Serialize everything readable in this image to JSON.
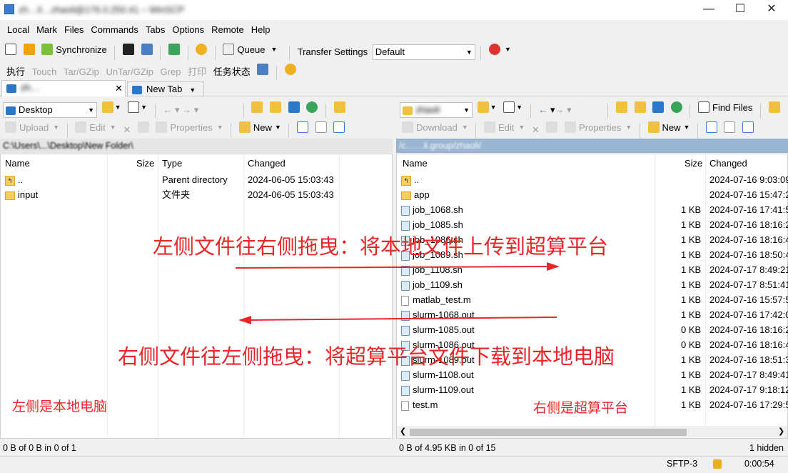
{
  "window": {
    "title": "zh…li…zhaoli@176.0.250.41 – WinSCP",
    "minimize": "—",
    "maximize": "☐",
    "close": "✕"
  },
  "menu": [
    "Local",
    "Mark",
    "Files",
    "Commands",
    "Tabs",
    "Options",
    "Remote",
    "Help"
  ],
  "toolbar1": {
    "synchronize": "Synchronize",
    "queue": "Queue",
    "transfer_settings": "Transfer Settings",
    "transfer_default": "Default"
  },
  "toolbar2": [
    "执行",
    "Touch",
    "Tar/GZip",
    "UnTar/GZip",
    "Grep",
    "打印",
    "任务状态"
  ],
  "tabs": {
    "session": "zh…",
    "new_tab": "New Tab"
  },
  "left": {
    "location": "Desktop",
    "upload": "Upload",
    "edit": "Edit",
    "properties": "Properties",
    "new": "New",
    "path": "C:\\Users\\...\\Desktop\\New Folder\\",
    "columns": {
      "name": "Name",
      "size": "Size",
      "type": "Type",
      "changed": "Changed"
    },
    "rows": [
      {
        "name": "..",
        "size": "",
        "type": "Parent directory",
        "changed": "2024-06-05 15:03:43"
      },
      {
        "name": "input",
        "size": "",
        "type": "文件夹",
        "changed": "2024-06-05 15:03:43"
      }
    ],
    "status": "0 B of 0 B in 0 of 1"
  },
  "right": {
    "location": "zhaoli",
    "find_files": "Find Files",
    "download": "Download",
    "edit": "Edit",
    "properties": "Properties",
    "new": "New",
    "path": "/c……li.group/zhaoli/",
    "columns": {
      "name": "Name",
      "size": "Size",
      "changed": "Changed"
    },
    "rows": [
      {
        "icon": "up",
        "name": "..",
        "size": "",
        "changed": "2024-07-16 9:03:09"
      },
      {
        "icon": "folder",
        "name": "app",
        "size": "",
        "changed": "2024-07-16 15:47:2"
      },
      {
        "icon": "file",
        "name": "job_1068.sh",
        "size": "1 KB",
        "changed": "2024-07-16 17:41:5"
      },
      {
        "icon": "file",
        "name": "job_1085.sh",
        "size": "1 KB",
        "changed": "2024-07-16 18:16:2"
      },
      {
        "icon": "file",
        "name": "job_1086.sh",
        "size": "1 KB",
        "changed": "2024-07-16 18:16:4"
      },
      {
        "icon": "file",
        "name": "job_1089.sh",
        "size": "1 KB",
        "changed": "2024-07-16 18:50:4"
      },
      {
        "icon": "file",
        "name": "job_1108.sh",
        "size": "1 KB",
        "changed": "2024-07-17 8:49:21"
      },
      {
        "icon": "file",
        "name": "job_1109.sh",
        "size": "1 KB",
        "changed": "2024-07-17 8:51:41"
      },
      {
        "icon": "txt",
        "name": "matlab_test.m",
        "size": "1 KB",
        "changed": "2024-07-16 15:57:5"
      },
      {
        "icon": "file",
        "name": "slurm-1068.out",
        "size": "1 KB",
        "changed": "2024-07-16 17:42:0"
      },
      {
        "icon": "file",
        "name": "slurm-1085.out",
        "size": "0 KB",
        "changed": "2024-07-16 18:16:2"
      },
      {
        "icon": "file",
        "name": "slurm-1086.out",
        "size": "0 KB",
        "changed": "2024-07-16 18:16:4"
      },
      {
        "icon": "file",
        "name": "slurm-1089.out",
        "size": "1 KB",
        "changed": "2024-07-16 18:51:3"
      },
      {
        "icon": "file",
        "name": "slurm-1108.out",
        "size": "1 KB",
        "changed": "2024-07-17 8:49:41"
      },
      {
        "icon": "file",
        "name": "slurm-1109.out",
        "size": "1 KB",
        "changed": "2024-07-17 9:18:12"
      },
      {
        "icon": "txt",
        "name": "test.m",
        "size": "1 KB",
        "changed": "2024-07-16 17:29:5"
      }
    ],
    "status": "0 B of 4.95 KB in 0 of 15",
    "hidden": "1 hidden"
  },
  "bottom": {
    "protocol": "SFTP-3",
    "time": "0:00:54"
  },
  "annotations": {
    "upload_hint": "左侧文件往右侧拖曳：将本地文件上传到超算平台",
    "download_hint": "右侧文件往左侧拖曳：将超算平台文件下载到本地电脑",
    "left_label": "左侧是本地电脑",
    "right_label": "右侧是超算平台",
    "color": "#e8262a"
  }
}
